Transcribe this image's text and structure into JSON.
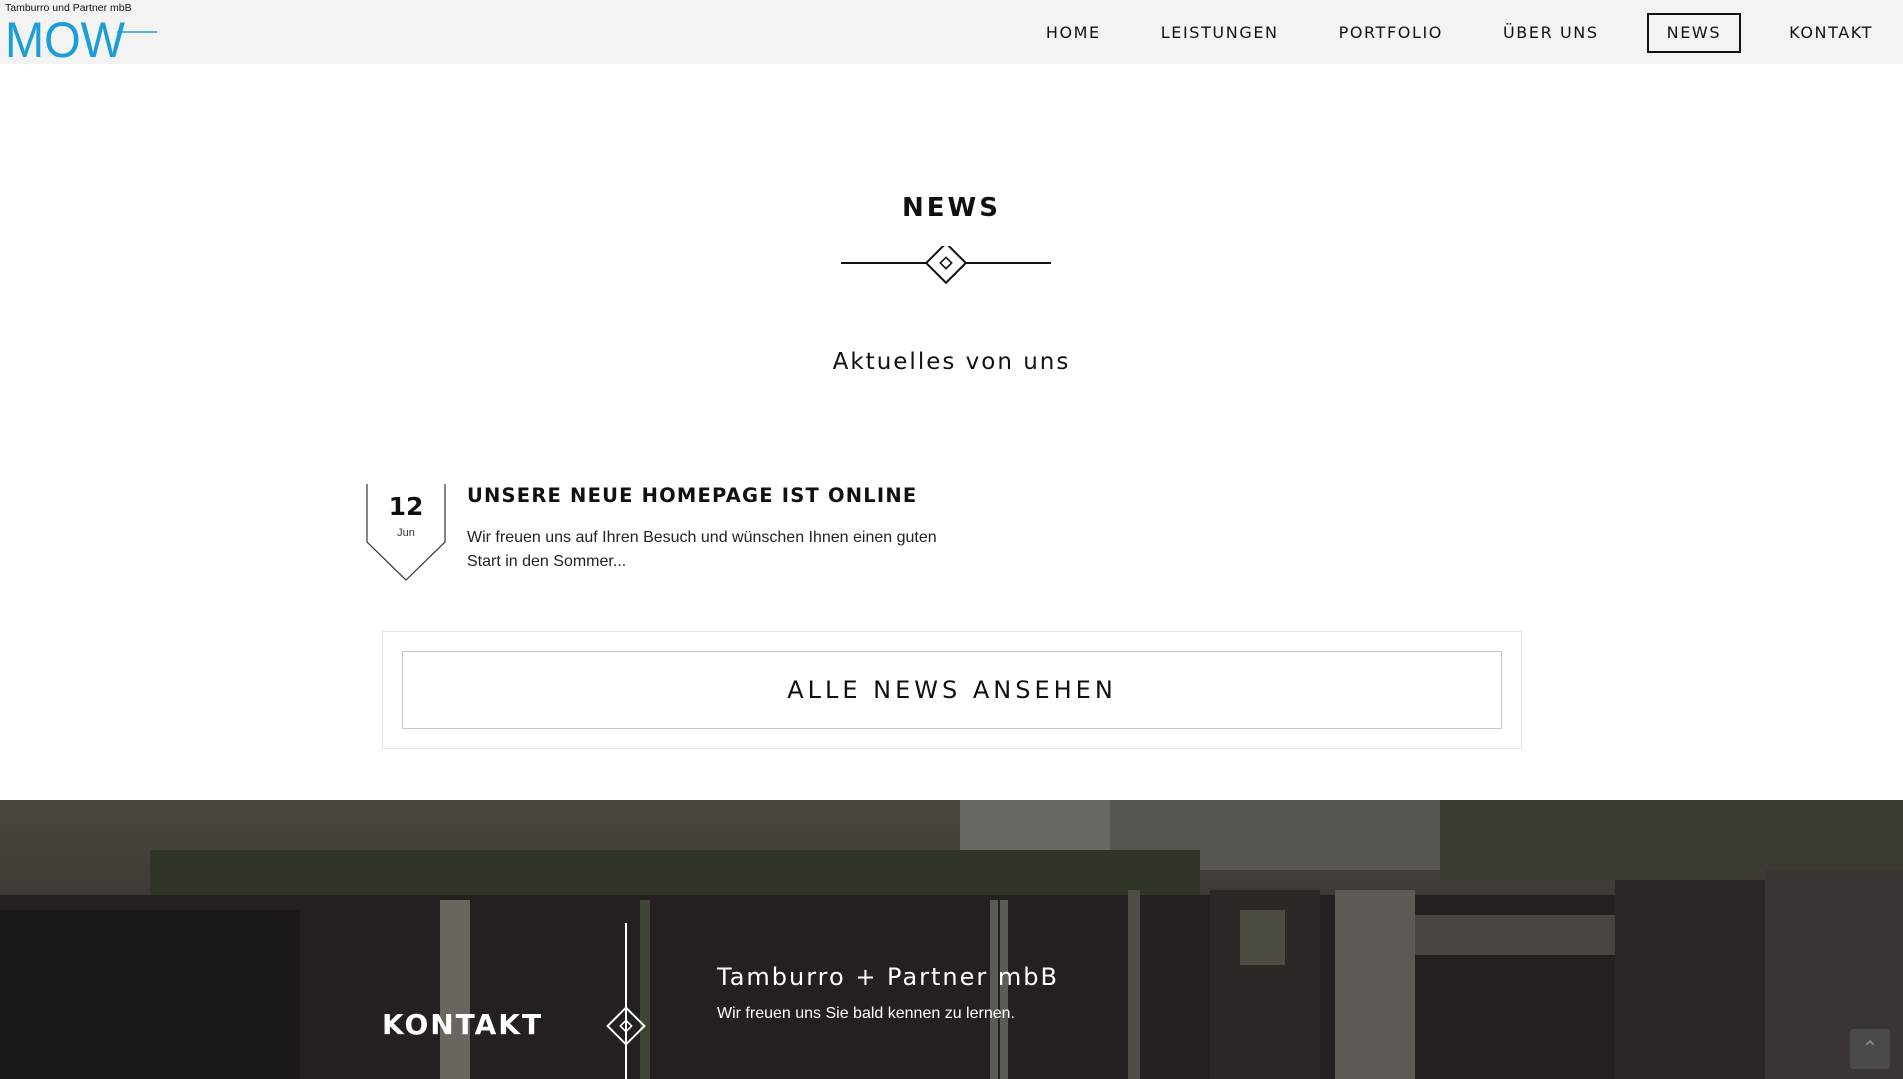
{
  "header": {
    "logo_tagline": "Tamburro und Partner mbB",
    "logo_text": "MOW",
    "logo_color": "#1a9ed9",
    "nav": [
      {
        "label": "HOME"
      },
      {
        "label": "LEISTUNGEN"
      },
      {
        "label": "PORTFOLIO"
      },
      {
        "label": "ÜBER UNS"
      },
      {
        "label": "NEWS",
        "active": true
      },
      {
        "label": "KONTAKT"
      }
    ]
  },
  "news_section": {
    "title": "NEWS",
    "subtitle": "Aktuelles von uns",
    "items": [
      {
        "day": "12",
        "month": "Jun",
        "title": "UNSERE NEUE HOMEPAGE IST ONLINE",
        "excerpt": "Wir freuen uns auf Ihren Besuch und wünschen Ihnen einen guten Start in den Sommer..."
      }
    ],
    "all_news_label": "ALLE NEWS ANSEHEN"
  },
  "contact_section": {
    "title": "KONTAKT",
    "company": "Tamburro + Partner mbB",
    "tagline": "Wir freuen uns Sie bald kennen zu lernen."
  },
  "icons": {
    "divider": "diamond-divider-icon",
    "scroll_top": "chevron-up-icon"
  }
}
